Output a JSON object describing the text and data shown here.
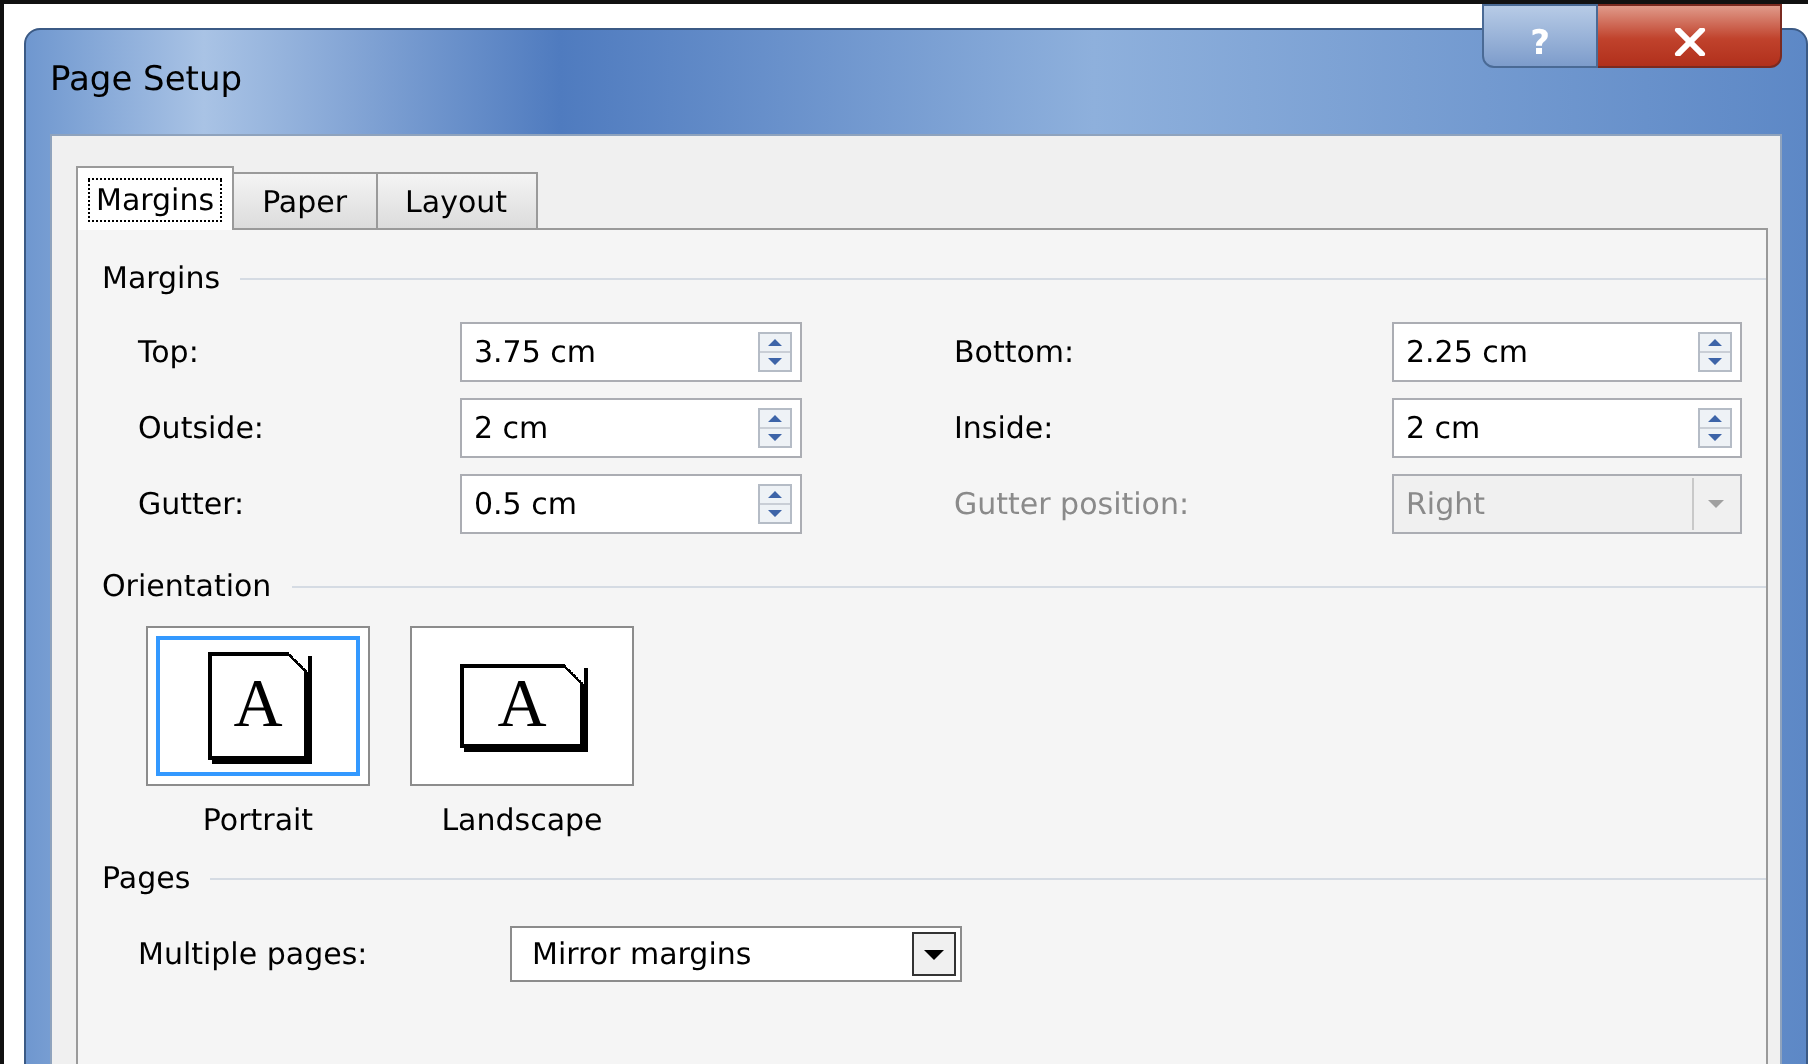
{
  "window": {
    "title": "Page Setup",
    "help": "?"
  },
  "tabs": [
    {
      "label": "Margins",
      "selected": true
    },
    {
      "label": "Paper",
      "selected": false
    },
    {
      "label": "Layout",
      "selected": false
    }
  ],
  "margins": {
    "title": "Margins",
    "fields": [
      {
        "label": "Top:",
        "value": "3.75 cm",
        "kind": "spin",
        "disabled": false
      },
      {
        "label": "Bottom:",
        "value": "2.25 cm",
        "kind": "spin",
        "disabled": false
      },
      {
        "label": "Outside:",
        "value": "2 cm",
        "kind": "spin",
        "disabled": false
      },
      {
        "label": "Inside:",
        "value": "2 cm",
        "kind": "spin",
        "disabled": false
      },
      {
        "label": "Gutter:",
        "value": "0.5 cm",
        "kind": "spin",
        "disabled": false
      },
      {
        "label": "Gutter position:",
        "value": "Right",
        "kind": "combo",
        "disabled": true
      }
    ]
  },
  "orientation": {
    "title": "Orientation",
    "options": [
      {
        "label": "Portrait",
        "glyph": "A",
        "kind": "portrait",
        "selected": true
      },
      {
        "label": "Landscape",
        "glyph": "A",
        "kind": "landscape",
        "selected": false
      }
    ]
  },
  "pages": {
    "title": "Pages",
    "label": "Multiple pages:",
    "value": "Mirror margins"
  }
}
